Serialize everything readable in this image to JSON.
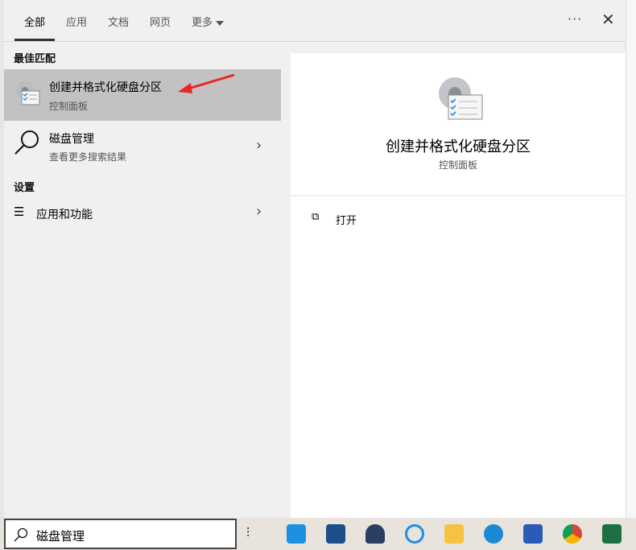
{
  "tabs": [
    {
      "label": "全部",
      "active": true
    },
    {
      "label": "应用"
    },
    {
      "label": "文档"
    },
    {
      "label": "网页"
    },
    {
      "label": "更多"
    }
  ],
  "more_label": "···",
  "sections": {
    "best_match": "最佳匹配",
    "settings": "设置"
  },
  "results": [
    {
      "title": "创建并格式化硬盘分区",
      "subtitle": "控制面板",
      "icon": "control-panel-gear-icon",
      "selected": true
    },
    {
      "title": "磁盘管理",
      "subtitle": "查看更多搜索结果",
      "icon": "search-icon"
    },
    {
      "title": "应用和功能",
      "icon": "list-icon"
    }
  ],
  "detail": {
    "title": "创建并格式化硬盘分区",
    "subtitle": "控制面板",
    "actions": [
      {
        "label": "打开",
        "icon": "open-icon"
      }
    ]
  },
  "search": {
    "value": "磁盘管理"
  },
  "taskbar": {
    "apps": [
      "task-view",
      "mail",
      "store",
      "cat-app",
      "chat",
      "file-explorer",
      "edge",
      "word",
      "chrome",
      "excel"
    ]
  },
  "colors": {
    "annotation_arrow": "#e8262a",
    "selected": "#c2c2c2"
  }
}
